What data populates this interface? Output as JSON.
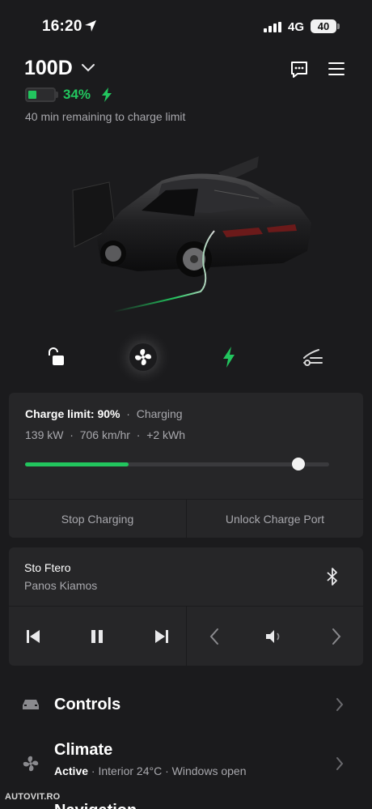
{
  "status_bar": {
    "time": "16:20",
    "network": "4G",
    "battery": "40"
  },
  "header": {
    "vehicle_name": "100D",
    "battery_percent": "34%",
    "battery_level": 0.34,
    "remaining": "40 min remaining to charge limit"
  },
  "quick_actions": [
    {
      "name": "lock",
      "icon": "unlock-icon"
    },
    {
      "name": "climate",
      "icon": "fan-icon"
    },
    {
      "name": "charge",
      "icon": "bolt-icon"
    },
    {
      "name": "frunk",
      "icon": "frunk-icon"
    }
  ],
  "charging": {
    "limit_label": "Charge limit: 90%",
    "status_label": "Charging",
    "separator": "·",
    "power": "139 kW",
    "speed": "706 km/hr",
    "added": "+2 kWh",
    "current_level": 0.34,
    "limit_level": 0.9,
    "stop_button": "Stop Charging",
    "unlock_button": "Unlock Charge Port"
  },
  "media": {
    "song": "Sto Ftero",
    "artist": "Panos Kiamos"
  },
  "list": {
    "controls": {
      "title": "Controls"
    },
    "climate": {
      "title": "Climate",
      "status": "Active",
      "detail": " · Interior 24°C · Windows open"
    },
    "next_partial": "Navigation"
  },
  "watermark": "AUTOVIT.RO",
  "colors": {
    "accent": "#22c55e",
    "background": "#1b1b1d",
    "card": "#262628"
  }
}
